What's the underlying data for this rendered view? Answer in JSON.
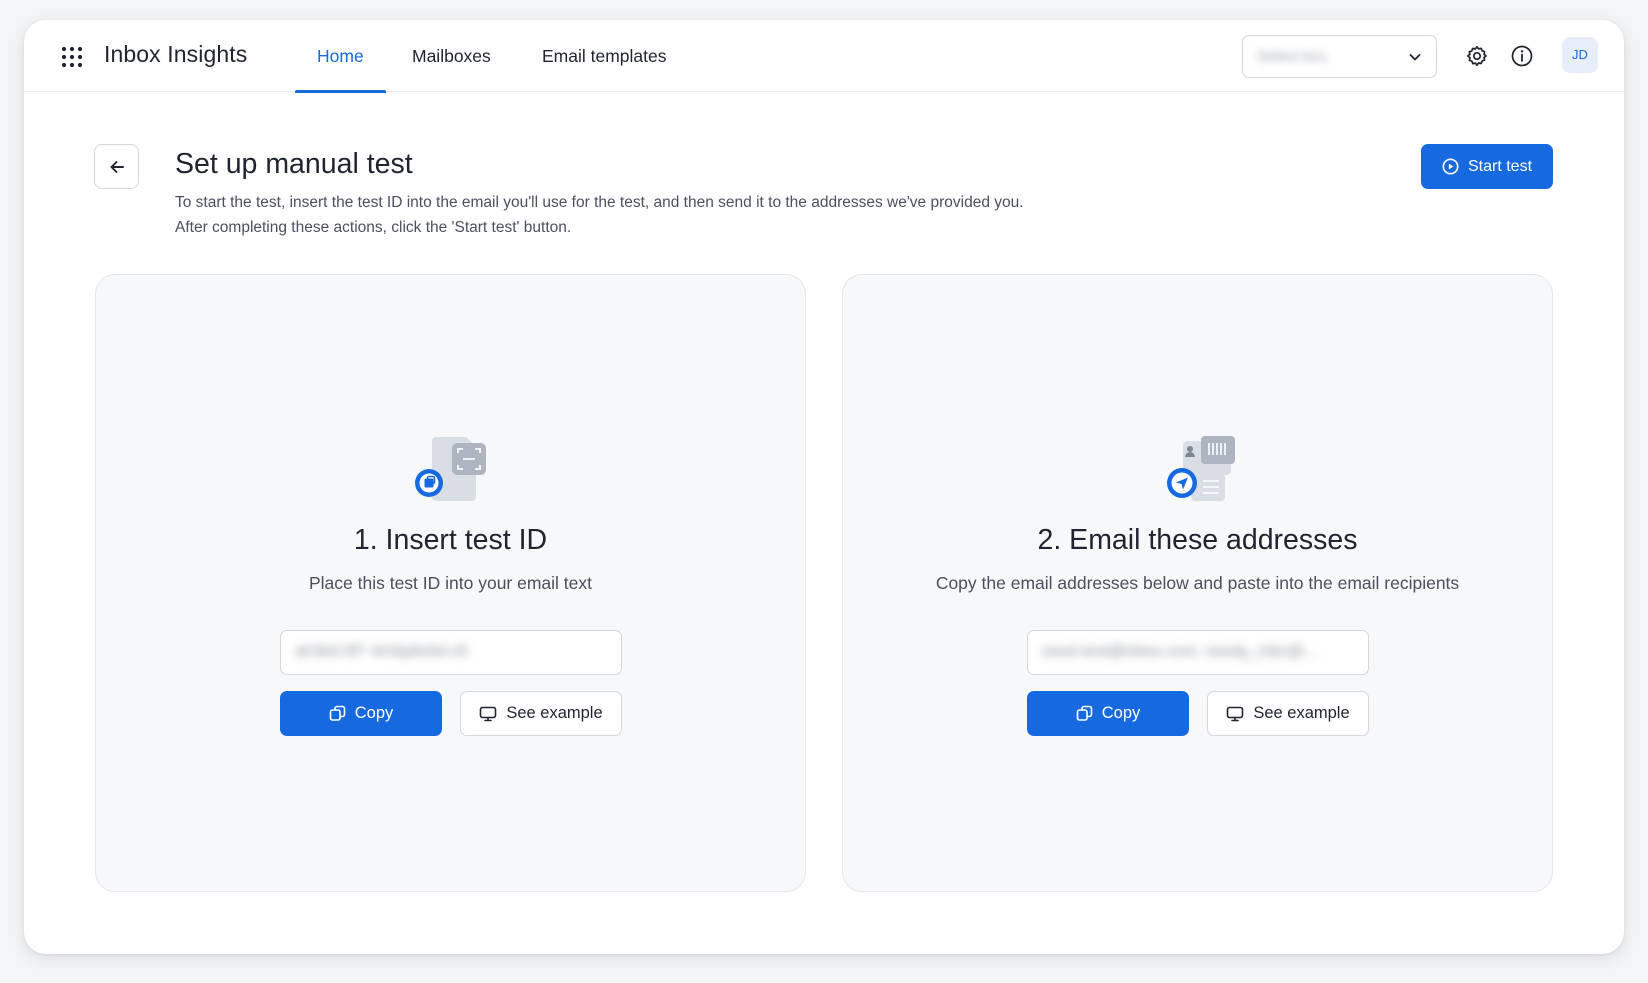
{
  "app": {
    "title": "Inbox Insights",
    "accent_color": "#1769e0"
  },
  "nav": {
    "tabs": [
      {
        "label": "Home",
        "active": true
      },
      {
        "label": "Mailboxes",
        "active": false
      },
      {
        "label": "Email templates",
        "active": false
      }
    ]
  },
  "header": {
    "account_select_value": "Select Acc",
    "settings_icon": "gear-icon",
    "info_icon": "info-icon",
    "avatar_initials": "JD"
  },
  "page": {
    "title": "Set up manual test",
    "description_line1": "To start the test, insert the test ID into the email you'll use for the test, and then send it to the addresses we've provided you.",
    "description_line2": "After completing these actions, click the 'Start test' button.",
    "start_button_label": "Start test",
    "back_icon": "arrow-left-icon"
  },
  "cards": [
    {
      "title": "1. Insert test ID",
      "subtitle": "Place this test ID into your email text",
      "field_value": "ah3kd-9f7 4m0p8x5d-c6",
      "copy_label": "Copy",
      "example_label": "See example",
      "illustration": "document-id-icon"
    },
    {
      "title": "2. Email these addresses",
      "subtitle": "Copy the email addresses below and paste into the email recipients",
      "field_value": "seed-test@inbox.com, seedy_mbx@...",
      "copy_label": "Copy",
      "example_label": "See example",
      "illustration": "send-addresses-icon"
    }
  ]
}
